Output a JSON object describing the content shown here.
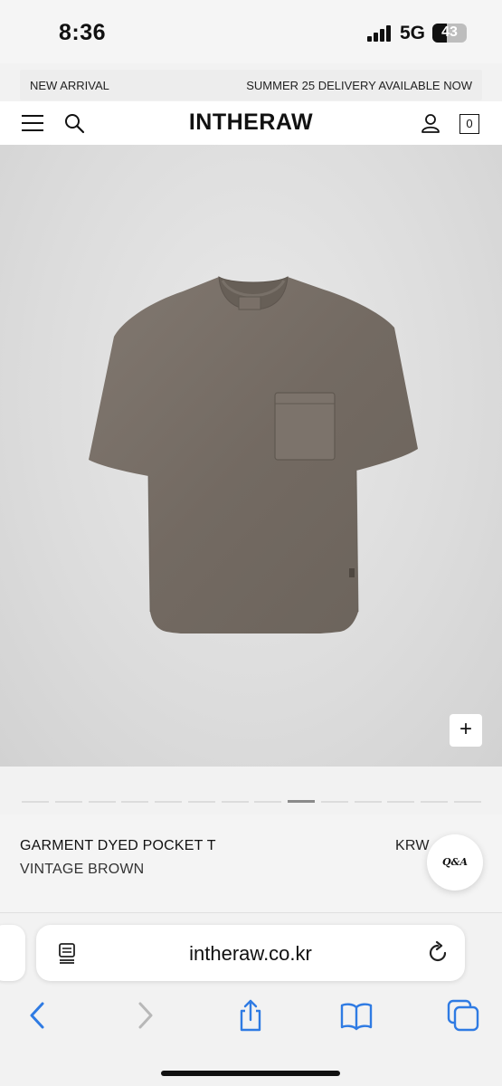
{
  "status_bar": {
    "time": "8:36",
    "network": "5G",
    "battery": "43",
    "battery_level_percent": 43
  },
  "announcement": {
    "left": "NEW ARRIVAL",
    "right": "SUMMER 25 DELIVERY AVAILABLE NOW"
  },
  "header": {
    "logo": "INTHERAW",
    "cart_count": "0"
  },
  "product_image": {
    "zoom_label": "+"
  },
  "pager": {
    "count": 14,
    "active_index": 8
  },
  "product": {
    "name": "GARMENT DYED POCKET T",
    "color": "VINTAGE BROWN",
    "price": "KRW",
    "qa_label": "Q&A"
  },
  "browser": {
    "url": "intheraw.co.kr"
  },
  "colors": {
    "shirt": "#776d65",
    "background": "#dcdcdc",
    "link_blue": "#2f7be3"
  },
  "icons": {
    "menu": "hamburger-icon",
    "search": "search-icon",
    "account": "user-icon",
    "reader": "reader-icon",
    "reload": "reload-icon",
    "back": "chevron-left-icon",
    "forward": "chevron-right-icon",
    "share": "share-icon",
    "bookmarks": "book-icon",
    "tabs": "tabs-icon"
  }
}
